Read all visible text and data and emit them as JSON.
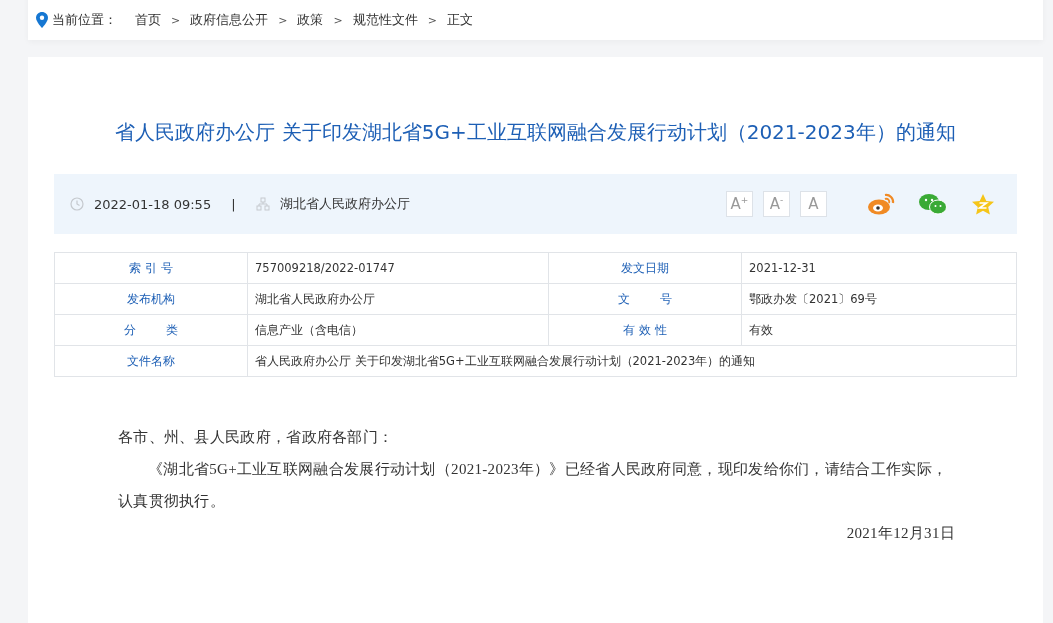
{
  "breadcrumb": {
    "label": "当前位置：",
    "separator": ">",
    "items": [
      "首页",
      "政府信息公开",
      "政策",
      "规范性文件",
      "正文"
    ]
  },
  "article": {
    "title": "省人民政府办公厅 关于印发湖北省5G+工业互联网融合发展行动计划（2021-2023年）的通知",
    "meta": {
      "date": "2022-01-18 09:55",
      "divider": "|",
      "publisher": "湖北省人民政府办公厅",
      "font_sizes": [
        "A$^{+}$",
        "A$^{-}$",
        "A"
      ]
    },
    "info_table": [
      {
        "cells": [
          {
            "label": "索 引 号",
            "value": "757009218/2022-01747"
          },
          {
            "label": "发文日期",
            "value": "2021-12-31"
          }
        ]
      },
      {
        "cells": [
          {
            "label": "发布机构",
            "value": "湖北省人民政府办公厅"
          },
          {
            "label": "文        号",
            "value": "鄂政办发〔2021〕69号"
          }
        ]
      },
      {
        "cells": [
          {
            "label": "分        类",
            "value": "信息产业（含电信）"
          },
          {
            "label": "有 效 性",
            "value": "有效"
          }
        ]
      },
      {
        "cells": [
          {
            "label": "文件名称",
            "value": "省人民政府办公厅 关于印发湖北省5G+工业互联网融合发展行动计划（2021-2023年）的通知"
          }
        ]
      }
    ],
    "body": [
      {
        "kind": "salutation",
        "text": "各市、州、县人民政府，省政府各部门："
      },
      {
        "kind": "paragraph",
        "text": "《湖北省5G+工业互联网融合发展行动计划（2021-2023年）》已经省人民政府同意，现印发给你们，请结合工作实际，认真贯彻执行。"
      },
      {
        "kind": "date",
        "text": "2021年12月31日"
      }
    ]
  }
}
